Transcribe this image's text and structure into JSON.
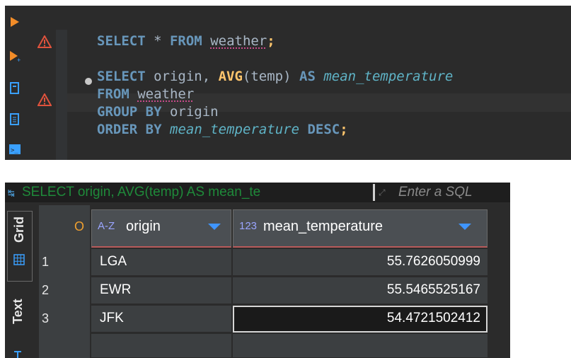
{
  "editor": {
    "lines": [
      {
        "parts": [
          {
            "t": "SELECT",
            "c": "kw2"
          },
          {
            "t": " * ",
            "c": ""
          },
          {
            "t": "FROM",
            "c": "kw2"
          },
          {
            "t": " ",
            "c": ""
          },
          {
            "t": "weather",
            "c": "tbl"
          },
          {
            "t": ";",
            "c": "fn"
          }
        ]
      },
      {
        "parts": []
      },
      {
        "parts": [
          {
            "t": "SELECT",
            "c": "kw2"
          },
          {
            "t": " origin, ",
            "c": ""
          },
          {
            "t": "AVG",
            "c": "fn"
          },
          {
            "t": "(temp) ",
            "c": ""
          },
          {
            "t": "AS",
            "c": "kw2"
          },
          {
            "t": " ",
            "c": ""
          },
          {
            "t": "mean_temperature",
            "c": "it"
          }
        ]
      },
      {
        "parts": [
          {
            "t": "FROM",
            "c": "kw2"
          },
          {
            "t": " ",
            "c": ""
          },
          {
            "t": "weather",
            "c": "tbl"
          }
        ]
      },
      {
        "parts": [
          {
            "t": "GROUP",
            "c": "kw2"
          },
          {
            "t": " ",
            "c": ""
          },
          {
            "t": "BY",
            "c": "kw2"
          },
          {
            "t": " origin",
            "c": ""
          }
        ]
      },
      {
        "parts": [
          {
            "t": "ORDER",
            "c": "kw2"
          },
          {
            "t": " ",
            "c": ""
          },
          {
            "t": "BY",
            "c": "kw2"
          },
          {
            "t": " ",
            "c": ""
          },
          {
            "t": "mean_temperature",
            "c": "it"
          },
          {
            "t": " ",
            "c": ""
          },
          {
            "t": "DESC",
            "c": "kw2"
          },
          {
            "t": ";",
            "c": "fn"
          }
        ]
      }
    ]
  },
  "results": {
    "query_text": "SELECT origin, AVG(temp) AS mean_te",
    "filter_placeholder": "Enter a SQL",
    "tabs": {
      "grid": "Grid",
      "text": "Text"
    },
    "corner_label": "O",
    "columns": [
      {
        "type_label": "A-Z",
        "name": "origin"
      },
      {
        "type_label": "123",
        "name": "mean_temperature"
      }
    ],
    "rows": [
      {
        "num": "1",
        "origin": "LGA",
        "mean_temperature": "55.7626050999"
      },
      {
        "num": "2",
        "origin": "EWR",
        "mean_temperature": "55.5465525167"
      },
      {
        "num": "3",
        "origin": "JFK",
        "mean_temperature": "54.4721502412"
      }
    ]
  },
  "colors": {
    "keyword": "#b4c1ff",
    "function": "#ffc66d",
    "alias": "#5fb3c6",
    "query_text": "#1f8a3a"
  }
}
